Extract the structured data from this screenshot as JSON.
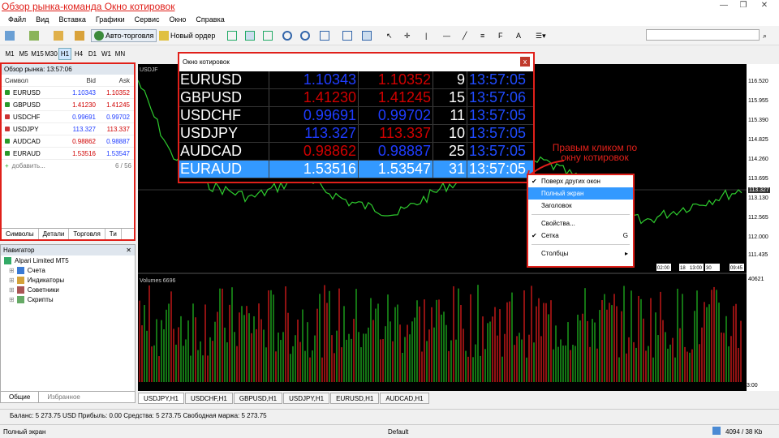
{
  "title": "Обзор рынка-команда Окно котировок",
  "menu": [
    "Файл",
    "Вид",
    "Вставка",
    "Графики",
    "Сервис",
    "Окно",
    "Справка"
  ],
  "toolbar": {
    "autotrade": "Авто-торговля",
    "new_order": "Новый ордер"
  },
  "timeframes": [
    "M1",
    "M5",
    "M15",
    "M30",
    "H1",
    "H4",
    "D1",
    "W1",
    "MN"
  ],
  "timeframe_selected": "H1",
  "market_watch": {
    "title": "Обзор рынка: 13:57:06",
    "col_symbol": "Символ",
    "col_bid": "Bid",
    "col_ask": "Ask",
    "rows": [
      {
        "symbol": "EURUSD",
        "bid": "1.10343",
        "ask": "1.10352",
        "bid_color": "#1f3cff",
        "ask_color": "#d00000",
        "dir": "up"
      },
      {
        "symbol": "GBPUSD",
        "bid": "1.41230",
        "ask": "1.41245",
        "bid_color": "#d00000",
        "ask_color": "#d00000",
        "dir": "up"
      },
      {
        "symbol": "USDCHF",
        "bid": "0.99691",
        "ask": "0.99702",
        "bid_color": "#1f3cff",
        "ask_color": "#1f3cff",
        "dir": "down"
      },
      {
        "symbol": "USDJPY",
        "bid": "113.327",
        "ask": "113.337",
        "bid_color": "#1f3cff",
        "ask_color": "#d00000",
        "dir": "down"
      },
      {
        "symbol": "AUDCAD",
        "bid": "0.98862",
        "ask": "0.98887",
        "bid_color": "#d00000",
        "ask_color": "#1f3cff",
        "dir": "up"
      },
      {
        "symbol": "EURAUD",
        "bid": "1.53516",
        "ask": "1.53547",
        "bid_color": "#d00000",
        "ask_color": "#1f3cff",
        "dir": "up"
      }
    ],
    "add_label": "добавить...",
    "count": "6 / 56",
    "tabs": [
      "Символы",
      "Детали",
      "Торговля",
      "Ти"
    ]
  },
  "navigator": {
    "title": "Навигатор",
    "root": "Alpari Limited MT5",
    "items": [
      "Счета",
      "Индикаторы",
      "Советники",
      "Скрипты"
    ],
    "tabs": [
      "Общие",
      "Избранное"
    ]
  },
  "quotes_window": {
    "title": "Окно котировок",
    "close": "x",
    "rows": [
      {
        "symbol": "EURUSD",
        "bid": "1.10343",
        "ask": "1.10352",
        "spread": "9",
        "time": "13:57:05",
        "bid_color": "#1f3cff",
        "ask_color": "#d00000"
      },
      {
        "symbol": "GBPUSD",
        "bid": "1.41230",
        "ask": "1.41245",
        "spread": "15",
        "time": "13:57:06",
        "bid_color": "#d00000",
        "ask_color": "#d00000"
      },
      {
        "symbol": "USDCHF",
        "bid": "0.99691",
        "ask": "0.99702",
        "spread": "11",
        "time": "13:57:05",
        "bid_color": "#1f3cff",
        "ask_color": "#1f3cff"
      },
      {
        "symbol": "USDJPY",
        "bid": "113.327",
        "ask": "113.337",
        "spread": "10",
        "time": "13:57:05",
        "bid_color": "#1f3cff",
        "ask_color": "#d00000"
      },
      {
        "symbol": "AUDCAD",
        "bid": "0.98862",
        "ask": "0.98887",
        "spread": "25",
        "time": "13:57:05",
        "bid_color": "#d00000",
        "ask_color": "#1f3cff"
      },
      {
        "symbol": "EURAUD",
        "bid": "1.53516",
        "ask": "1.53547",
        "spread": "31",
        "time": "13:57:05",
        "bid_color": "#ffffff",
        "ask_color": "#ffffff"
      }
    ]
  },
  "annotation": "Правым кликом по окну котировок",
  "context_menu": {
    "items": [
      {
        "label": "Поверх других окон",
        "checked": "✔",
        "shortcut": ""
      },
      {
        "label": "Полный экран",
        "checked": "",
        "shortcut": ""
      },
      {
        "label": "Заголовок",
        "checked": "",
        "shortcut": ""
      },
      {
        "label": "Свойства...",
        "checked": "",
        "shortcut": ""
      },
      {
        "label": "Сетка",
        "checked": "✔",
        "shortcut": "G"
      },
      {
        "label": "Столбцы",
        "checked": "",
        "shortcut": "▸"
      }
    ]
  },
  "chart": {
    "symbol_label": "USDJF",
    "volumes_label": "Volumes 6696",
    "price_ticks": [
      "116.520",
      "115.955",
      "115.390",
      "114.825",
      "114.260",
      "113.695",
      "113.327",
      "113.130",
      "112.565",
      "112.000",
      "111.435",
      "40621"
    ],
    "time_ticks": [
      "8 Feb 2016",
      "9 Feb 05:00",
      "9 Feb 13:00",
      "9 Feb 21:00",
      "10 Feb 05:00",
      "10 Feb 13:00",
      "10 Feb 21:00",
      "11 Feb 05:00",
      "11 Feb 13:00",
      "11 Feb 21:00",
      "12 Feb 05:00",
      "12 Feb 13:00",
      "12 Feb 21:00",
      "15 Feb 05:00",
      "15 Feb 13:00",
      "15 Feb 21:00",
      "16 Feb 05:00",
      "16 Feb 13:00",
      "16 Feb 21:00",
      "17 Feb 05:00",
      "17 Feb 13:00",
      "17 Feb 21:00",
      "18 Feb 05:00",
      "18 Feb 13:00",
      "18 Feb 21:00",
      "19 Feb 05:00",
      "19 Feb 13:00",
      "19 Feb 21:00",
      "22 Feb 13:00"
    ],
    "markers": [
      "02:00",
      "18",
      "13:00",
      "30",
      "09:45"
    ]
  },
  "chart_tabs": [
    "USDJPY,H1",
    "USDCHF,H1",
    "GBPUSD,H1",
    "USDJPY,H1",
    "EURUSD,H1",
    "AUDCAD,H1"
  ],
  "balance": "Баланс: 5 273.75 USD  Прибыль: 0.00  Средства: 5 273.75  Свободная маржа: 5 273.75",
  "status": {
    "left": "Полный экран",
    "center": "Default",
    "right": "4094 / 38 Kb"
  }
}
